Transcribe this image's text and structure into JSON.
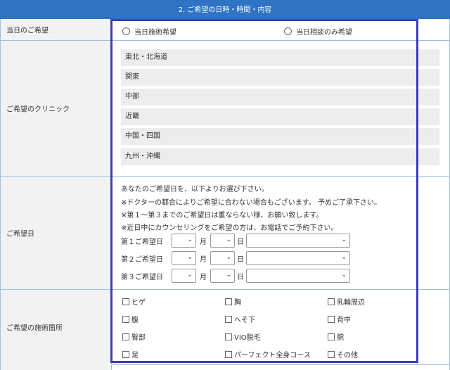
{
  "header": {
    "title": "2. ご希望の日時・時間・内容"
  },
  "same_day": {
    "label": "当日のご希望",
    "options": [
      "当日施術希望",
      "当日相談のみ希望"
    ]
  },
  "clinic": {
    "label": "ご希望のクリニック",
    "regions": [
      "東北・北海道",
      "関東",
      "中部",
      "近畿",
      "中国・四国",
      "九州・沖縄"
    ]
  },
  "date": {
    "label": "ご希望日",
    "notes": [
      "あなたのご希望日を、以下よりお選び下さい。",
      "※ドクターの都合によりご希望に合わない場合もございます。 予めご了承下さい。",
      "※第１～第３までのご希望日は重ならない様、お願い致します。",
      "※近日中にカウンセリングをご希望の方は、お電話でご予約下さい。"
    ],
    "choices": [
      "第１ご希望日",
      "第２ご希望日",
      "第３ご希望日"
    ],
    "month_unit": "月",
    "day_unit": "日"
  },
  "area": {
    "label": "ご希望の施術箇所",
    "items": [
      "ヒゲ",
      "胸",
      "乳輪周辺",
      "腹",
      "へそ下",
      "背中",
      "臀部",
      "VIO脱毛",
      "腕",
      "足",
      "パーフェクト全身コース",
      "その他"
    ]
  },
  "colors": {
    "header": "#2e73c4",
    "border": "#a3bfe0",
    "highlight": "#3b3fb5"
  }
}
